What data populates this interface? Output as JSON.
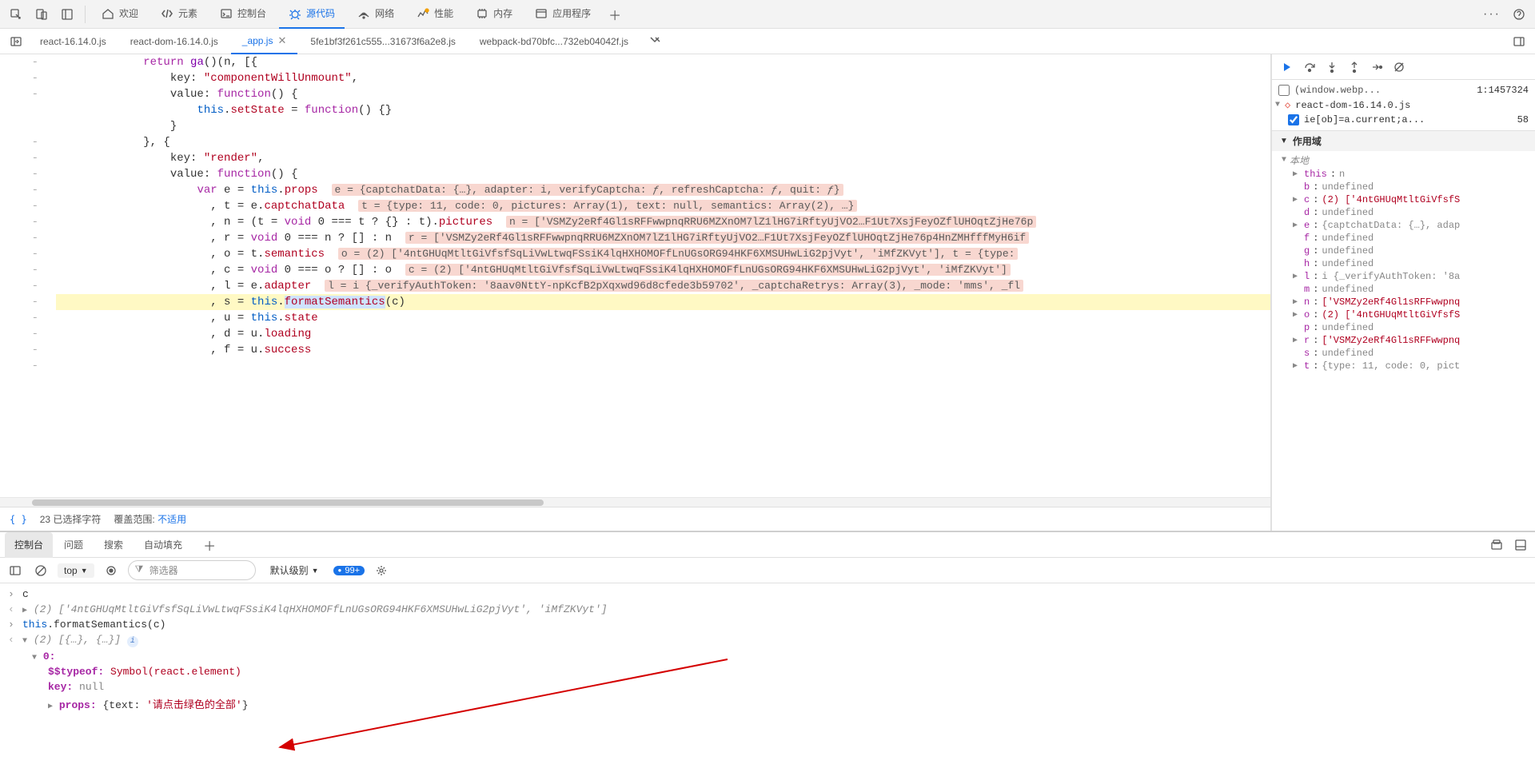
{
  "toolbar": {
    "tabs": [
      {
        "icon": "home",
        "label": "欢迎"
      },
      {
        "icon": "code",
        "label": "元素"
      },
      {
        "icon": "console",
        "label": "控制台"
      },
      {
        "icon": "bug",
        "label": "源代码"
      },
      {
        "icon": "network",
        "label": "网络"
      },
      {
        "icon": "perf",
        "label": "性能"
      },
      {
        "icon": "mem",
        "label": "内存"
      },
      {
        "icon": "app",
        "label": "应用程序"
      }
    ],
    "active": 3
  },
  "filetabs": {
    "items": [
      {
        "label": "react-16.14.0.js"
      },
      {
        "label": "react-dom-16.14.0.js"
      },
      {
        "label": "_app.js",
        "active": true,
        "closeable": true
      },
      {
        "label": "5fe1bf3f261c555...31673f6a2e8.js"
      },
      {
        "label": "webpack-bd70bfc...732eb04042f.js"
      }
    ]
  },
  "code": {
    "gutter_marks": [
      "-",
      "-",
      "-",
      "",
      "",
      "-",
      "-",
      "-",
      "-",
      "-",
      "-",
      "-",
      "-",
      "-",
      "-",
      "-",
      "-",
      "-",
      "-",
      "-"
    ],
    "selection_word": "formatSemantics"
  },
  "infobar": {
    "chars": "23 已选择字符",
    "coverage_label": "覆盖范围:",
    "coverage_value": "不适用"
  },
  "sidebar": {
    "cursor": "1:1457324",
    "watch_file": "(window.webp...",
    "bp_file": "react-dom-16.14.0.js",
    "bp_expr": "ie[ob]=a.current;a...",
    "bp_count": "58",
    "scope_header": "作用域",
    "local_label": "本地",
    "vars": [
      {
        "k": "this",
        "v": "n",
        "exp": true
      },
      {
        "k": "b",
        "v": "undefined"
      },
      {
        "k": "c",
        "v": "(2) ['4ntGHUqMtltGiVfsfS",
        "exp": true,
        "str": true
      },
      {
        "k": "d",
        "v": "undefined"
      },
      {
        "k": "e",
        "v": "{captchatData: {…}, adap",
        "exp": true
      },
      {
        "k": "f",
        "v": "undefined"
      },
      {
        "k": "g",
        "v": "undefined"
      },
      {
        "k": "h",
        "v": "undefined"
      },
      {
        "k": "l",
        "v": "i {_verifyAuthToken: '8a",
        "exp": true
      },
      {
        "k": "m",
        "v": "undefined"
      },
      {
        "k": "n",
        "v": "['VSMZy2eRf4Gl1sRFFwwpnq",
        "exp": true,
        "str": true
      },
      {
        "k": "o",
        "v": "(2) ['4ntGHUqMtltGiVfsfS",
        "exp": true,
        "str": true
      },
      {
        "k": "p",
        "v": "undefined"
      },
      {
        "k": "r",
        "v": "['VSMZy2eRf4Gl1sRFFwwpnq",
        "exp": true,
        "str": true
      },
      {
        "k": "s",
        "v": "undefined"
      },
      {
        "k": "t",
        "v": "{type: 11, code: 0, pict",
        "exp": true
      }
    ]
  },
  "drawer": {
    "tabs": [
      "控制台",
      "问题",
      "搜索",
      "自动填充"
    ],
    "active": 0
  },
  "console_toolbar": {
    "context": "top",
    "filter_placeholder": "筛选器",
    "level": "默认级别",
    "badge": "99+"
  },
  "console": {
    "in1": "c",
    "out1_count": "(2)",
    "out1_arr": "['4ntGHUqMtltGiVfsfSqLiVwLtwqFSsiK4lqHXHOMOFfLnUGsORG94HKF6XMSUHwLiG2pjVyt', 'iMfZKVyt']",
    "in2": "this.formatSemantics(c)",
    "out2_count": "(2)",
    "out2_arr": "[{…}, {…}]",
    "obj_index": "0:",
    "typeof_k": "$$typeof:",
    "typeof_v": "Symbol(react.element)",
    "key_k": "key:",
    "key_v": "null",
    "props_k": "props:",
    "props_v": "{text: '请点击绿色的全部'}"
  }
}
